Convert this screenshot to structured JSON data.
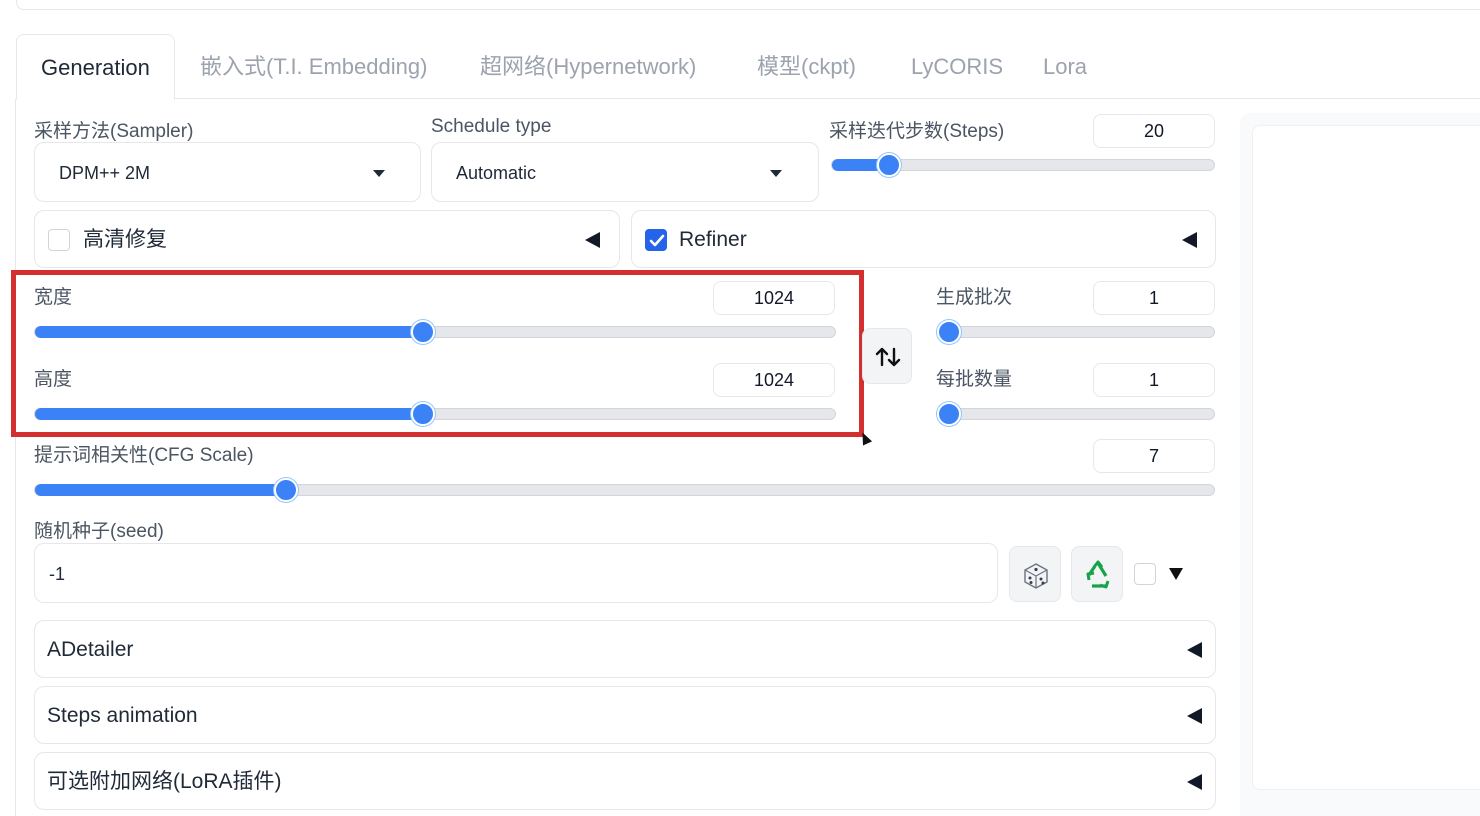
{
  "tabs": [
    {
      "label": "Generation",
      "active": true
    },
    {
      "label": "嵌入式(T.I. Embedding)",
      "active": false
    },
    {
      "label": "超网络(Hypernetwork)",
      "active": false
    },
    {
      "label": "模型(ckpt)",
      "active": false
    },
    {
      "label": "LyCORIS",
      "active": false
    },
    {
      "label": "Lora",
      "active": false
    }
  ],
  "sampler": {
    "label": "采样方法(Sampler)",
    "value": "DPM++ 2M"
  },
  "schedule": {
    "label": "Schedule type",
    "value": "Automatic"
  },
  "steps": {
    "label": "采样迭代步数(Steps)",
    "value": "20",
    "fraction": 0.15
  },
  "hires": {
    "label": "高清修复",
    "checked": false
  },
  "refiner": {
    "label": "Refiner",
    "checked": true
  },
  "width": {
    "label": "宽度",
    "value": "1024",
    "fraction": 0.485
  },
  "height": {
    "label": "高度",
    "value": "1024",
    "fraction": 0.485
  },
  "batch_count": {
    "label": "生成批次",
    "value": "1",
    "fraction": 0.0
  },
  "batch_size": {
    "label": "每批数量",
    "value": "1",
    "fraction": 0.0
  },
  "cfg": {
    "label": "提示词相关性(CFG Scale)",
    "value": "7",
    "fraction": 0.213
  },
  "seed": {
    "label": "随机种子(seed)",
    "value": "-1"
  },
  "accordions": [
    {
      "label": "ADetailer"
    },
    {
      "label": "Steps animation"
    },
    {
      "label": "可选附加网络(LoRA插件)"
    }
  ],
  "icons": {
    "swap": "swap-arrows-icon",
    "dice": "dice-icon",
    "recycle": "recycle-icon"
  },
  "colors": {
    "accent": "#3b82f6",
    "highlight": "#d32f2f"
  }
}
